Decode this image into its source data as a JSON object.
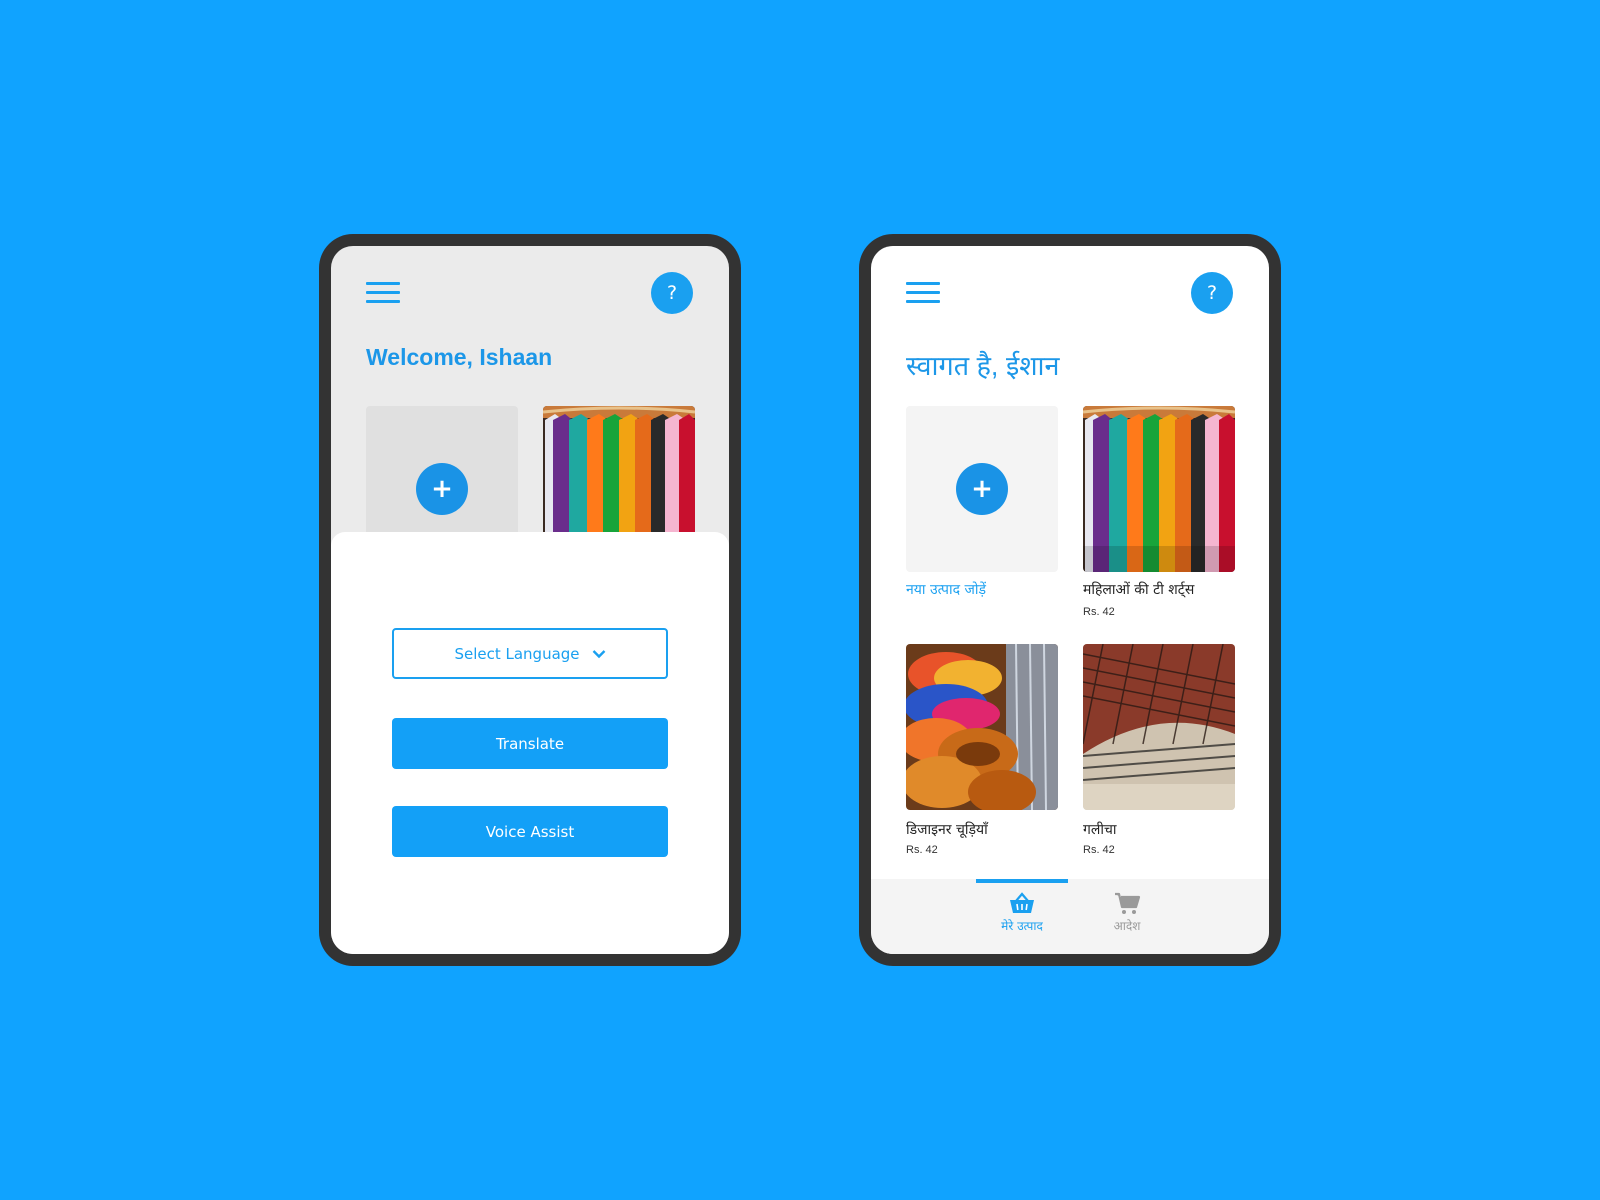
{
  "colors": {
    "background": "#10a3ff",
    "accent": "#1aa0f0",
    "frame": "#333333"
  },
  "left_screen": {
    "welcome": "Welcome, Ishaan",
    "help_label": "?",
    "add_symbol": "+",
    "sheet": {
      "select_language": "Select Language",
      "translate": "Translate",
      "voice_assist": "Voice Assist"
    }
  },
  "right_screen": {
    "welcome": "स्वागत है, ईशान",
    "help_label": "?",
    "add_symbol": "+",
    "add_label": "नया उत्पाद जोड़ें",
    "products": [
      {
        "name": "महिलाओं की टी शर्ट्स",
        "price": "Rs. 42",
        "icon": "tshirts-image"
      },
      {
        "name": "डिजाइनर चूड़ियाँ",
        "price": "Rs. 42",
        "icon": "bangles-image"
      },
      {
        "name": "गलीचा",
        "price": "Rs. 42",
        "icon": "carpet-image"
      }
    ],
    "nav": {
      "products": {
        "label": "मेरे उत्पाद",
        "icon": "basket-icon",
        "active": true
      },
      "orders": {
        "label": "आदेश",
        "icon": "cart-icon",
        "active": false
      }
    }
  }
}
